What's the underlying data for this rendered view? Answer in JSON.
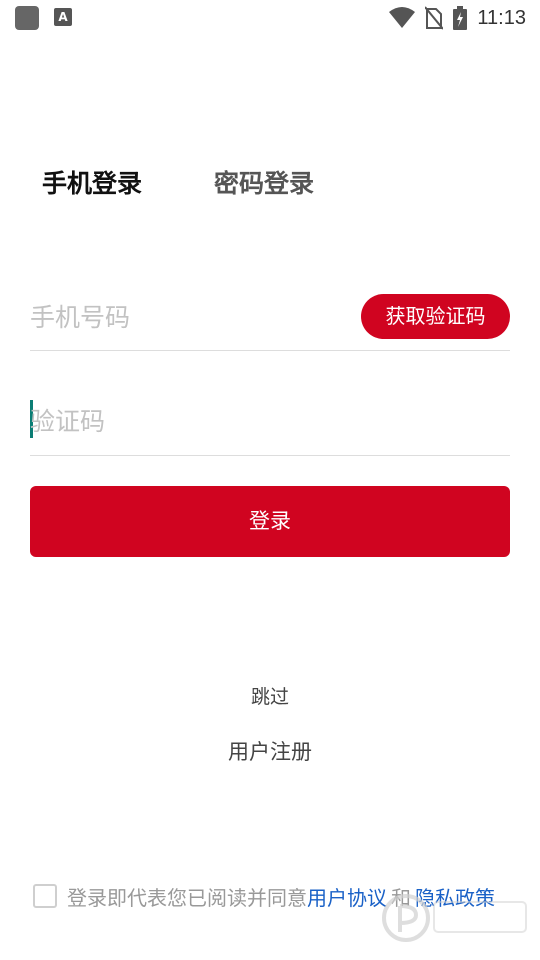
{
  "status_bar": {
    "time": "11:13",
    "indicator_letter": "A",
    "icons": [
      "app-icon",
      "font-notification-icon",
      "wifi-icon",
      "no-sim-icon",
      "battery-charging-icon"
    ]
  },
  "tabs": [
    {
      "label": "手机登录",
      "active": true
    },
    {
      "label": "密码登录",
      "active": false
    }
  ],
  "phone_field": {
    "placeholder": "手机号码",
    "value": ""
  },
  "code_field": {
    "placeholder": "验证码",
    "value": ""
  },
  "get_code_button": {
    "label": "获取验证码"
  },
  "login_button": {
    "label": "登录"
  },
  "skip_link": {
    "label": "跳过"
  },
  "register_link": {
    "label": "用户注册"
  },
  "agreement": {
    "checked": false,
    "text": "登录即代表您已阅读并同意",
    "user_agreement": "用户协议",
    "and": "和",
    "privacy_policy": "隐私政策"
  },
  "colors": {
    "accent": "#d00420",
    "link": "#1a61c7",
    "placeholder": "#c2c2c2",
    "cursor": "#0b7d74"
  }
}
